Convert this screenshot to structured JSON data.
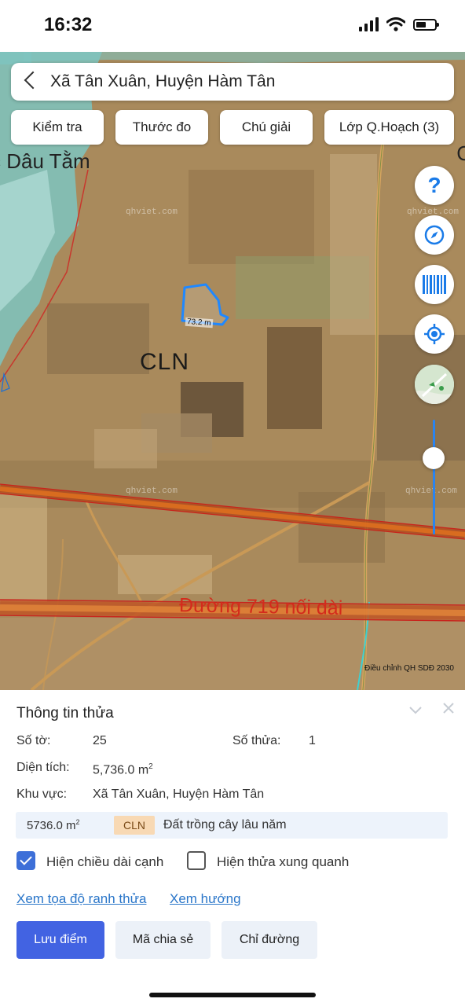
{
  "status_bar": {
    "time": "16:32"
  },
  "search": {
    "title": "Xã Tân Xuân, Huyện Hàm Tân"
  },
  "toolbar": {
    "check_label": "Kiểm tra",
    "ruler_label": "Thước đo",
    "legend_label": "Chú giải",
    "layers_label": "Lớp Q.Hoạch (3)"
  },
  "map": {
    "place_label": "c Dâu Tằm",
    "edge_label": "C",
    "land_type": "CLN",
    "edge_length": "73.2 m",
    "road_label": "Đường 719 nối dài",
    "watermark": "qhviet.com",
    "plan_label": "Điều chỉnh QH SDĐ 2030"
  },
  "controls": {
    "help_glyph": "?",
    "accent_color": "#1a7be8",
    "icons": [
      "help-icon",
      "compass-icon",
      "barcode-icon",
      "locate-icon",
      "map-layer-icon"
    ]
  },
  "parcel": {
    "title": "Thông tin thửa",
    "sheet_label": "Số tờ:",
    "sheet_value": "25",
    "parcel_label": "Số thửa:",
    "parcel_value": "1",
    "area_label": "Diện tích:",
    "area_value": "5,736.0 m",
    "area_unit_sup": "2",
    "region_label": "Khu vực:",
    "region_value": "Xã Tân Xuân, Huyện Hàm Tân",
    "landuse": {
      "area": "5736.0 m",
      "area_sup": "2",
      "code": "CLN",
      "description": "Đất trồng cây lâu năm"
    },
    "show_edge_length_label": "Hiện chiều dài cạnh",
    "show_edge_length_checked": true,
    "show_neighbors_label": "Hiện thửa xung quanh",
    "show_neighbors_checked": false,
    "link_boundary": "Xem tọa độ ranh thửa",
    "link_direction": "Xem hướng",
    "btn_save": "Lưu điểm",
    "btn_share": "Mã chia sẻ",
    "btn_route": "Chỉ đường"
  }
}
